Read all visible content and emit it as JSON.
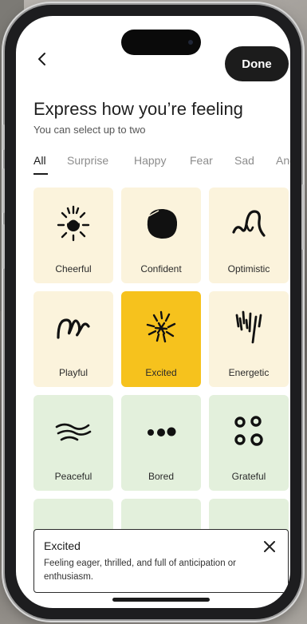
{
  "header": {
    "back_icon": "chevron-left-icon",
    "done_label": "Done"
  },
  "heading": {
    "title": "Express how you’re feeling",
    "subtitle": "You can select up to two"
  },
  "tabs": [
    {
      "label": "All",
      "active": true
    },
    {
      "label": "Surprise",
      "active": false
    },
    {
      "label": "Happy",
      "active": false
    },
    {
      "label": "Fear",
      "active": false
    },
    {
      "label": "Sad",
      "active": false
    },
    {
      "label": "Ang",
      "active": false
    }
  ],
  "feelings": [
    {
      "label": "Cheerful",
      "theme": "warm",
      "selected": false,
      "icon": "cheerful-sun-icon"
    },
    {
      "label": "Confident",
      "theme": "warm",
      "selected": false,
      "icon": "confident-blob-icon"
    },
    {
      "label": "Optimistic",
      "theme": "warm",
      "selected": false,
      "icon": "optimistic-wave-icon"
    },
    {
      "label": "Playful",
      "theme": "warm",
      "selected": false,
      "icon": "playful-loops-icon"
    },
    {
      "label": "Excited",
      "theme": "warm",
      "selected": true,
      "icon": "excited-burst-icon"
    },
    {
      "label": "Energetic",
      "theme": "warm",
      "selected": false,
      "icon": "energetic-strokes-icon"
    },
    {
      "label": "Peaceful",
      "theme": "green",
      "selected": false,
      "icon": "peaceful-waves-icon"
    },
    {
      "label": "Bored",
      "theme": "green",
      "selected": false,
      "icon": "bored-dots-icon"
    },
    {
      "label": "Grateful",
      "theme": "green",
      "selected": false,
      "icon": "grateful-circles-icon"
    }
  ],
  "selection_panel": {
    "title": "Excited",
    "description": "Feeling eager, thrilled, and full of anticipation or enthusiasm.",
    "close_icon": "close-icon"
  },
  "colors": {
    "accent_selected": "#f6c21d",
    "warm_card": "#fbf3dc",
    "green_card": "#e3f0dc",
    "dark_button": "#1c1c1c"
  }
}
